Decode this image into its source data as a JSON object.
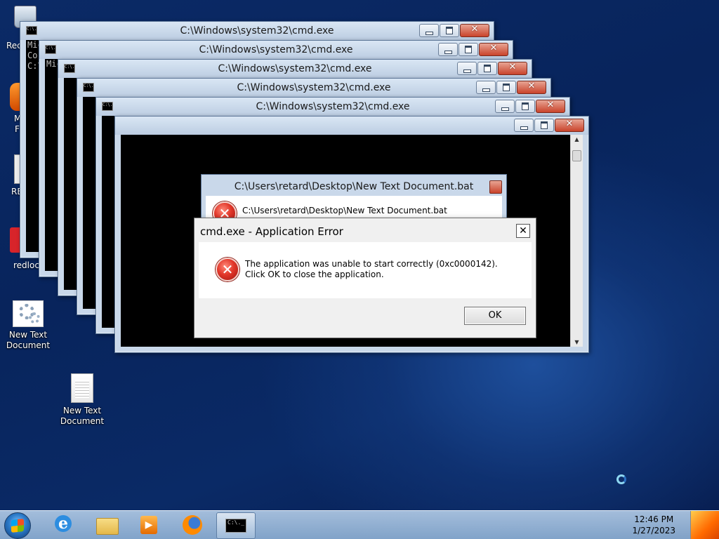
{
  "desktop": {
    "icons": [
      {
        "label": "New Text\nDocument",
        "kind": "gear-document"
      },
      {
        "label": "New Text\nDocument",
        "kind": "text-document"
      }
    ],
    "partial_labels": [
      "Rec",
      "M",
      "F",
      "RE",
      "redlock"
    ]
  },
  "cmd_windows": {
    "title": "C:\\Windows\\system32\\cmd.exe",
    "console_lines": [
      "Mic",
      "Co",
      "C:\\"
    ],
    "sysicon_text": "C:\\."
  },
  "bat_dialog": {
    "title": "C:\\Users\\retard\\Desktop\\New Text Document.bat",
    "message": "C:\\Users\\retard\\Desktop\\New Text Document.bat"
  },
  "error_dialog": {
    "title": "cmd.exe - Application Error",
    "close_glyph": "✕",
    "message": "The application was unable to start correctly (0xc0000142). Click OK to close the application.",
    "ok_label": "OK"
  },
  "taskbar": {
    "clock_time": "12:46 PM",
    "clock_date": "1/27/2023",
    "cmd_icon_text": "C:\\._"
  },
  "icons": [
    "recycle-bin-icon",
    "gear-document-icon",
    "text-document-icon",
    "error-icon",
    "start-orb-icon",
    "internet-explorer-icon",
    "explorer-folder-icon",
    "media-player-icon",
    "firefox-icon",
    "cmd-icon",
    "busy-cursor-icon"
  ]
}
